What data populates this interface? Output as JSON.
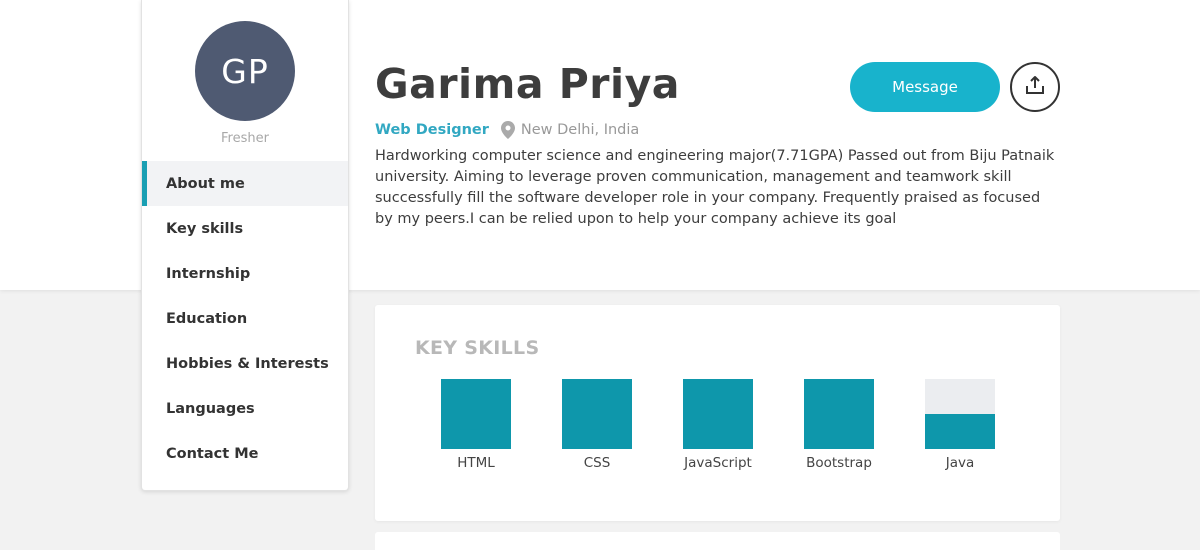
{
  "profile": {
    "initials": "GP",
    "status": "Fresher",
    "name": "Garima Priya",
    "role": "Web Designer",
    "location": "New Delhi, India",
    "bio": "Hardworking computer science and engineering major(7.71GPA) Passed out from Biju Patnaik university. Aiming to leverage proven communication, management and teamwork skill successfully fill the software developer role in your company. Frequently praised as focused by my peers.I can be relied upon to help your company achieve its goal"
  },
  "actions": {
    "message_label": "Message",
    "share_icon": "share-upload-icon"
  },
  "nav": {
    "items": [
      {
        "label": "About me",
        "active": true
      },
      {
        "label": "Key skills",
        "active": false
      },
      {
        "label": "Internship",
        "active": false
      },
      {
        "label": "Education",
        "active": false
      },
      {
        "label": "Hobbies & Interests",
        "active": false
      },
      {
        "label": "Languages",
        "active": false
      },
      {
        "label": "Contact Me",
        "active": false
      }
    ]
  },
  "skills": {
    "title": "KEY SKILLS",
    "items": [
      {
        "name": "HTML",
        "level": 1.0
      },
      {
        "name": "CSS",
        "level": 1.0
      },
      {
        "name": "JavaScript",
        "level": 1.0
      },
      {
        "name": "Bootstrap",
        "level": 1.0
      },
      {
        "name": "Java",
        "level": 0.5
      }
    ]
  },
  "colors": {
    "accent": "#18b3cc",
    "skill_fill": "#0e97ab",
    "avatar_bg": "#4f5a72",
    "role_text": "#32a8c2"
  }
}
